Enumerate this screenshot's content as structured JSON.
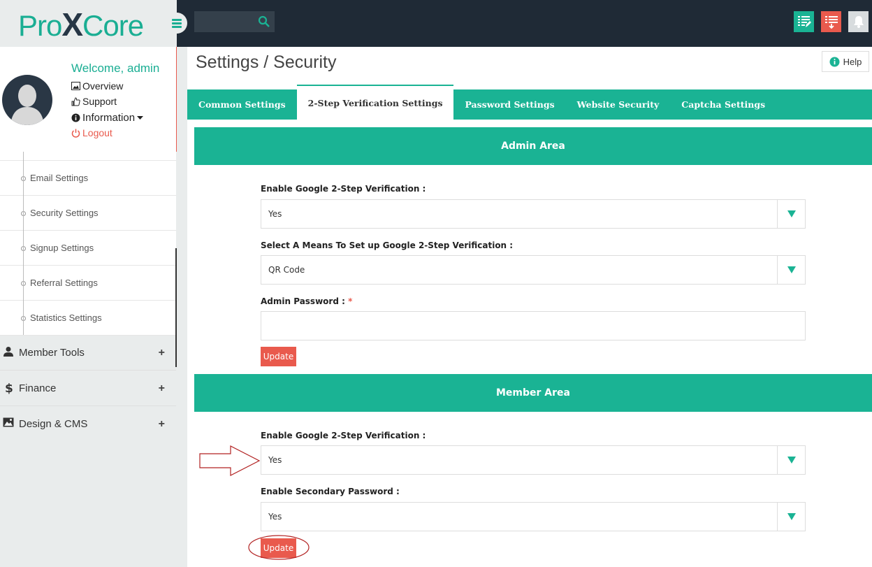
{
  "header": {
    "logo_part1": "Pro",
    "logo_part2": "X",
    "logo_part3": "Core",
    "search": {
      "placeholder": "",
      "value": ""
    },
    "icons": [
      "menu-icon",
      "search-icon",
      "edit-list-icon",
      "download-list-icon",
      "bell-icon"
    ]
  },
  "profile": {
    "welcome": "Welcome, admin",
    "links": [
      "Overview",
      "Support",
      "Information",
      "Logout"
    ]
  },
  "sidebar": {
    "sub_items": [
      "Email Settings",
      "Security Settings",
      "Signup Settings",
      "Referral Settings",
      "Statistics Settings"
    ],
    "main_items": [
      {
        "label": "Member Tools",
        "icon": "user-icon"
      },
      {
        "label": "Finance",
        "icon": "dollar-icon"
      },
      {
        "label": "Design & CMS",
        "icon": "image-icon"
      }
    ],
    "expand_symbol": "+"
  },
  "page": {
    "title": "Settings / Security",
    "help_label": "Help"
  },
  "tabs": [
    "Common Settings",
    "2-Step Verification Settings",
    "Password Settings",
    "Website Security",
    "Captcha Settings"
  ],
  "admin_area": {
    "title": "Admin Area",
    "enable_label": "Enable Google 2-Step Verification :",
    "enable_value": "Yes",
    "means_label": "Select A Means To Set up Google 2-Step Verification :",
    "means_value": "QR Code",
    "password_label": "Admin Password :",
    "required_mark": "*",
    "password_value": "",
    "update_label": "Update"
  },
  "member_area": {
    "title": "Member Area",
    "enable_label": "Enable Google 2-Step Verification :",
    "enable_value": "Yes",
    "secondary_label": "Enable Secondary Password :",
    "secondary_value": "Yes",
    "update_label": "Update"
  },
  "colors": {
    "accent": "#1ab394",
    "danger": "#e95a4d",
    "dark": "#1f2a36"
  }
}
